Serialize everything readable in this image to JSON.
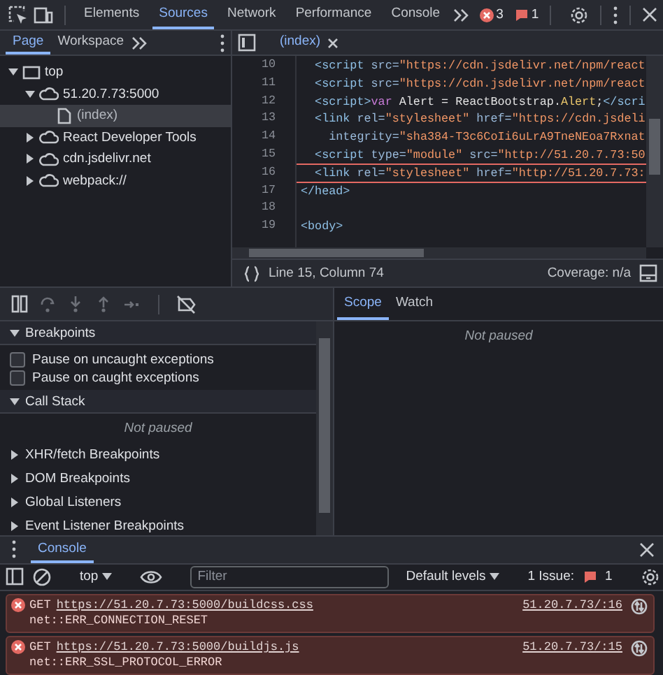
{
  "toolbar": {
    "tabs": [
      {
        "label": "Elements",
        "selected": false
      },
      {
        "label": "Sources",
        "selected": true
      },
      {
        "label": "Network",
        "selected": false
      },
      {
        "label": "Performance",
        "selected": false
      },
      {
        "label": "Console",
        "selected": false
      }
    ],
    "error_count": "3",
    "issue_count": "1"
  },
  "navigator": {
    "tabs": [
      {
        "label": "Page",
        "selected": true
      },
      {
        "label": "Workspace",
        "selected": false
      }
    ],
    "tree": [
      {
        "label": "top",
        "kind": "frame",
        "expanded": true,
        "selected": false,
        "children": [
          {
            "label": "51.20.7.73:5000",
            "kind": "origin",
            "expanded": true,
            "selected": false,
            "children": [
              {
                "label": "(index)",
                "kind": "file",
                "selected": true
              }
            ]
          },
          {
            "label": "React Developer Tools",
            "kind": "origin",
            "expanded": false,
            "selected": false
          },
          {
            "label": "cdn.jsdelivr.net",
            "kind": "origin",
            "expanded": false,
            "selected": false
          },
          {
            "label": "webpack://",
            "kind": "origin",
            "expanded": false,
            "selected": false
          }
        ]
      }
    ]
  },
  "editor": {
    "tabs": [
      {
        "label": "(index)",
        "selected": true
      }
    ],
    "lines": [
      {
        "number": "10",
        "error": false,
        "segments": [
          {
            "kind": "tag",
            "text": "  <script "
          },
          {
            "kind": "attr",
            "text": "src="
          },
          {
            "kind": "str",
            "text": "\"https://cdn.jsdelivr.net/npm/react"
          }
        ]
      },
      {
        "number": "11",
        "error": false,
        "segments": [
          {
            "kind": "tag",
            "text": "  <script "
          },
          {
            "kind": "attr",
            "text": "src="
          },
          {
            "kind": "str",
            "text": "\"https://cdn.jsdelivr.net/npm/react"
          }
        ]
      },
      {
        "number": "12",
        "error": false,
        "segments": [
          {
            "kind": "tag",
            "text": "  <script>"
          },
          {
            "kind": "kw",
            "text": "var "
          },
          {
            "kind": "text",
            "text": "Alert = ReactBootstrap."
          },
          {
            "kind": "prop",
            "text": "Alert"
          },
          {
            "kind": "text",
            "text": ";"
          },
          {
            "kind": "tag",
            "text": "</scri"
          }
        ]
      },
      {
        "number": "13",
        "error": false,
        "segments": [
          {
            "kind": "tag",
            "text": "  <link "
          },
          {
            "kind": "attr",
            "text": "rel="
          },
          {
            "kind": "str",
            "text": "\"stylesheet\" "
          },
          {
            "kind": "attr",
            "text": "href="
          },
          {
            "kind": "str",
            "text": "\"https://cdn.jsdeli"
          }
        ]
      },
      {
        "number": "14",
        "error": false,
        "segments": [
          {
            "kind": "attr",
            "text": "    integrity="
          },
          {
            "kind": "str",
            "text": "\"sha384-T3c6CoIi6uLrA9TneNEoa7Rxnat"
          }
        ]
      },
      {
        "number": "15",
        "error": true,
        "segments": [
          {
            "kind": "tag",
            "text": "  <script "
          },
          {
            "kind": "attr",
            "text": "type="
          },
          {
            "kind": "str",
            "text": "\"module\" "
          },
          {
            "kind": "attr",
            "text": "src="
          },
          {
            "kind": "str",
            "text": "\"http://51.20.7.73:50"
          }
        ]
      },
      {
        "number": "16",
        "error": true,
        "segments": [
          {
            "kind": "tag",
            "text": "  <link "
          },
          {
            "kind": "attr",
            "text": "rel="
          },
          {
            "kind": "str",
            "text": "\"stylesheet\" "
          },
          {
            "kind": "attr",
            "text": "href="
          },
          {
            "kind": "str",
            "text": "\"http://51.20.7.73:"
          }
        ]
      },
      {
        "number": "17",
        "error": false,
        "segments": [
          {
            "kind": "tag",
            "text": "</head>"
          }
        ]
      },
      {
        "number": "18"
      },
      {
        "number": "19",
        "error": false,
        "segments": [
          {
            "kind": "tag",
            "text": "<body>"
          }
        ]
      }
    ],
    "position": "Line 15, Column 74",
    "coverage": "Coverage: n/a"
  },
  "debugger": {
    "sections": [
      {
        "title": "Breakpoints",
        "expanded": true,
        "kind": "checkboxes",
        "items": [
          {
            "label": "Pause on uncaught exceptions",
            "checked": false
          },
          {
            "label": "Pause on caught exceptions",
            "checked": false
          }
        ]
      },
      {
        "title": "Call Stack",
        "expanded": true,
        "kind": "message",
        "message": "Not paused"
      },
      {
        "title": "XHR/fetch Breakpoints",
        "expanded": false
      },
      {
        "title": "DOM Breakpoints",
        "expanded": false
      },
      {
        "title": "Global Listeners",
        "expanded": false
      },
      {
        "title": "Event Listener Breakpoints",
        "expanded": false
      }
    ],
    "side_tabs": [
      {
        "label": "Scope",
        "selected": true
      },
      {
        "label": "Watch",
        "selected": false
      }
    ],
    "side_message": "Not paused"
  },
  "console": {
    "tabs": [
      {
        "label": "Console",
        "selected": true
      }
    ],
    "context": "top",
    "filter_placeholder": "Filter",
    "levels": "Default levels",
    "issues_label": "1 Issue:",
    "issues_count": "1",
    "messages": [
      {
        "kind": "error",
        "method": "GET",
        "url": "https://51.20.7.73:5000/buildcss.css",
        "detail": "net::ERR_CONNECTION_RESET",
        "source": "51.20.7.73/:16"
      },
      {
        "kind": "error",
        "method": "GET",
        "url": "https://51.20.7.73:5000/buildjs.js",
        "detail": "net::ERR_SSL_PROTOCOL_ERROR",
        "source": "51.20.7.73/:15"
      }
    ]
  }
}
